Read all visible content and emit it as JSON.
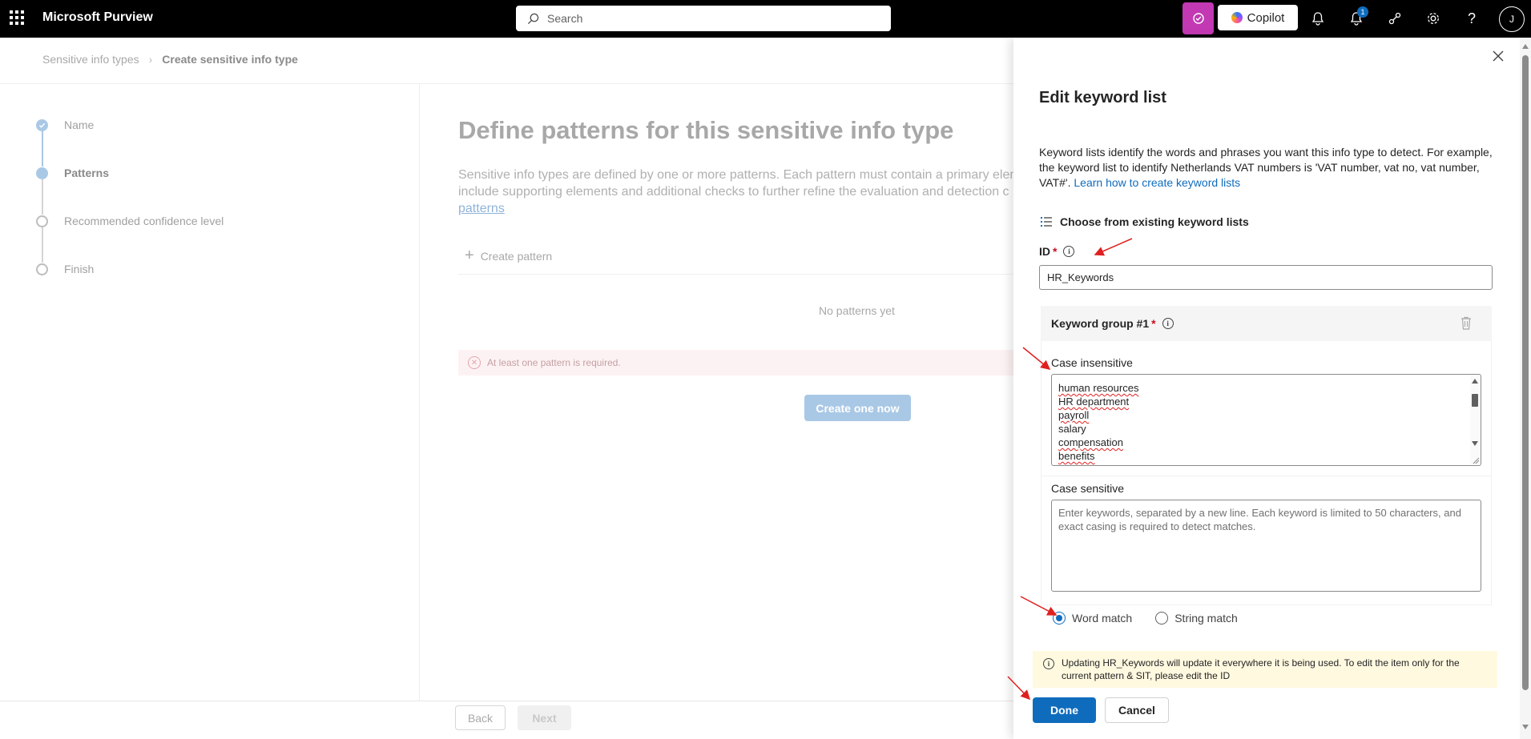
{
  "topbar": {
    "app_name": "Microsoft Purview",
    "search_placeholder": "Search",
    "copilot_label": "Copilot",
    "notification_count": "1",
    "avatar_initial": "J"
  },
  "breadcrumb": {
    "items": [
      "Sensitive info types",
      "Create sensitive info type"
    ]
  },
  "wizard": {
    "steps": [
      {
        "label": "Name",
        "state": "done"
      },
      {
        "label": "Patterns",
        "state": "active"
      },
      {
        "label": "Recommended confidence level",
        "state": "pending"
      },
      {
        "label": "Finish",
        "state": "pending"
      }
    ]
  },
  "main": {
    "title": "Define patterns for this sensitive info type",
    "description_line1": "Sensitive info types are defined by one or more patterns. Each pattern must contain a primary elem",
    "description_line2": "include supporting elements and additional checks to further refine the evaluation and detection c",
    "description_link": "patterns",
    "create_pattern_label": "Create pattern",
    "empty_text": "No patterns yet",
    "error_text": "At least one pattern is required.",
    "create_now_label": "Create one now",
    "back_label": "Back",
    "next_label": "Next"
  },
  "panel": {
    "title": "Edit keyword list",
    "description": "Keyword lists identify the words and phrases you want this info type to detect. For example, the keyword list to identify Netherlands VAT numbers is 'VAT number, vat no, vat number, VAT#'.",
    "learn_link": "Learn how to create keyword lists",
    "choose_existing_label": "Choose from existing keyword lists",
    "id_label": "ID",
    "required_mark": "*",
    "id_value": "HR_Keywords",
    "keyword_group_label": "Keyword group #1",
    "case_insensitive_label": "Case insensitive",
    "case_insensitive_keywords": [
      "human resources",
      "HR department",
      "payroll",
      "salary",
      "compensation",
      "benefits"
    ],
    "case_sensitive_label": "Case sensitive",
    "case_sensitive_placeholder": "Enter keywords, separated by a new line. Each keyword is limited to 50 characters, and exact casing is required to detect matches.",
    "word_match_label": "Word match",
    "string_match_label": "String match",
    "selected_match": "Word match",
    "warning_text": "Updating HR_Keywords will update it everywhere it is being used. To edit the item only for the current pattern & SIT, please edit the ID",
    "done_label": "Done",
    "cancel_label": "Cancel"
  },
  "colors": {
    "accent": "#0f6cbd",
    "topbar": "#000000",
    "copilot_pink": "#c239b3",
    "warning_bg": "#fff9e0",
    "annotation_arrow": "#e02020"
  }
}
